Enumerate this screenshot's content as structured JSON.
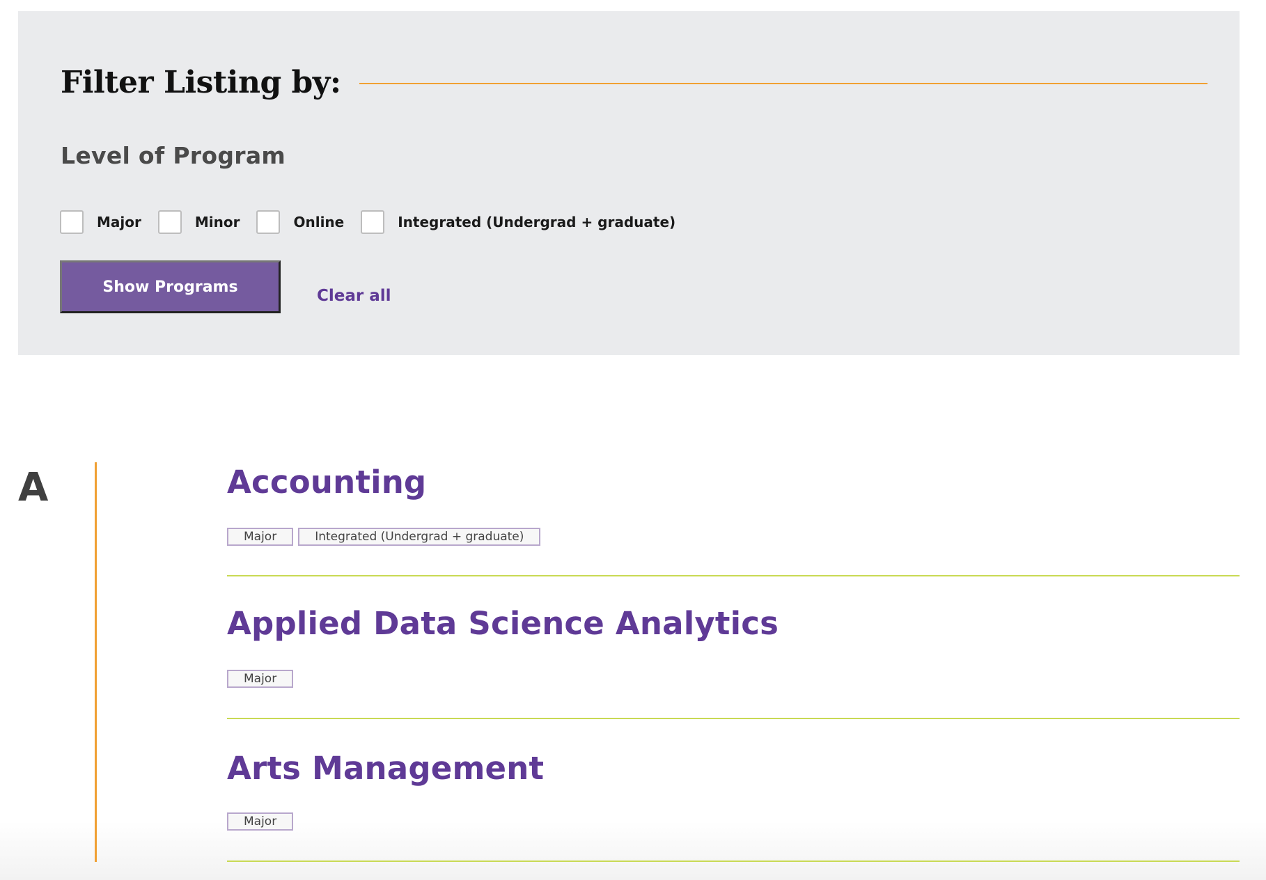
{
  "filter": {
    "title": "Filter Listing by:",
    "section_heading": "Level of Program",
    "options": [
      {
        "label": "Major",
        "checked": false
      },
      {
        "label": "Minor",
        "checked": false
      },
      {
        "label": "Online",
        "checked": false
      },
      {
        "label": "Integrated (Undergrad + graduate)",
        "checked": false
      }
    ],
    "submit_label": "Show Programs",
    "clear_label": "Clear all"
  },
  "listing": {
    "letter": "A",
    "programs": [
      {
        "title": "Accounting",
        "tags": [
          "Major",
          "Integrated (Undergrad + graduate)"
        ]
      },
      {
        "title": "Applied Data Science Analytics",
        "tags": [
          "Major"
        ]
      },
      {
        "title": "Arts Management",
        "tags": [
          "Major"
        ]
      }
    ]
  },
  "colors": {
    "accent_purple": "#5f3a96",
    "button_purple": "#755b9f",
    "orange_rule": "#f0a033",
    "green_rule": "#c9da54",
    "panel_bg": "#eaebed"
  }
}
